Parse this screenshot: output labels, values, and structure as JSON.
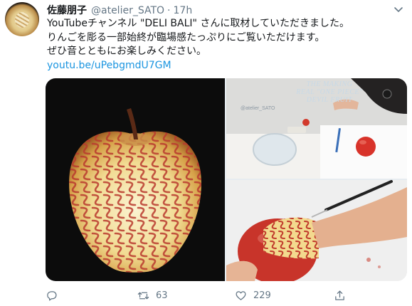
{
  "author": {
    "display_name": "佐藤朋子",
    "handle": "@atelier_SATO",
    "separator": "·",
    "timestamp": "17h"
  },
  "tweet": {
    "lines": [
      "YouTubeチャンネル \"DELI BALI\" さんに取材していただきました。",
      "りんごを彫る一部始終が臨場感たっぷりにご覧いただけます。",
      "ぜひ音とともにお楽しみください。"
    ],
    "link": "youtu.be/uPebgmdU7GM"
  },
  "media": {
    "video_overlay_lines": [
      "THE MAKING",
      "REAL \"ONE PIECE\"",
      "DEVIL FRUIT"
    ],
    "watermark": "@atelier_SATO"
  },
  "actions": {
    "retweet_count": "63",
    "like_count": "229"
  },
  "colors": {
    "link": "#1b95e0",
    "secondary_text": "#657786"
  }
}
